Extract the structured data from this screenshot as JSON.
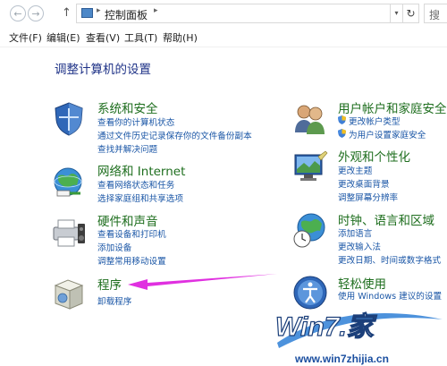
{
  "address_bar": {
    "path": "控制面板",
    "search_text": "搜"
  },
  "menu": [
    "文件(F)",
    "编辑(E)",
    "查看(V)",
    "工具(T)",
    "帮助(H)"
  ],
  "page_title": "调整计算机的设置",
  "categories": {
    "system": {
      "title": "系统和安全",
      "links": [
        "查看你的计算机状态",
        "通过文件历史记录保存你的文件备份副本",
        "查找并解决问题"
      ]
    },
    "network": {
      "title": "网络和 Internet",
      "links": [
        "查看网络状态和任务",
        "选择家庭组和共享选项"
      ]
    },
    "hardware": {
      "title": "硬件和声音",
      "links": [
        "查看设备和打印机",
        "添加设备",
        "调整常用移动设置"
      ]
    },
    "programs": {
      "title": "程序",
      "links": [
        "卸载程序"
      ]
    },
    "users": {
      "title": "用户帐户和家庭安全",
      "links": [
        "更改帐户类型",
        "为用户设置家庭安全"
      ]
    },
    "appearance": {
      "title": "外观和个性化",
      "links": [
        "更改主题",
        "更改桌面背景",
        "调整屏幕分辨率"
      ]
    },
    "clock": {
      "title": "时钟、语言和区域",
      "links": [
        "添加语言",
        "更改输入法",
        "更改日期、时间或数字格式"
      ]
    },
    "ease": {
      "title": "轻松使用",
      "links": [
        "使用 Windows 建议的设置"
      ]
    }
  },
  "watermark": {
    "text": "Win7.家",
    "sub": "www.win7zhijia.cn"
  },
  "colors": {
    "accent_arrow": "#e030e0",
    "category_title": "#1e6e1e",
    "link": "#1a56a6",
    "page_title": "#1e3287"
  }
}
